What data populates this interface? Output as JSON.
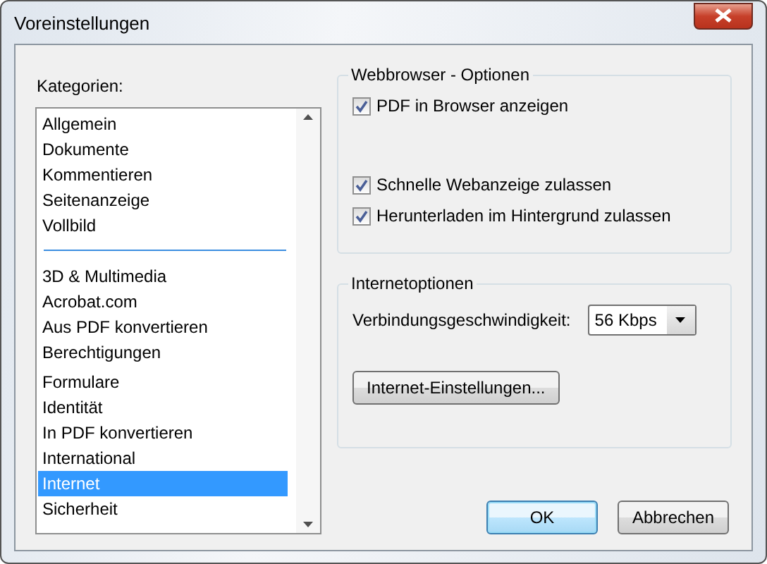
{
  "window": {
    "title": "Voreinstellungen"
  },
  "categories": {
    "label": "Kategorien:",
    "groups": [
      [
        {
          "label": "Allgemein",
          "selected": false
        },
        {
          "label": "Dokumente",
          "selected": false
        },
        {
          "label": "Kommentieren",
          "selected": false
        },
        {
          "label": "Seitenanzeige",
          "selected": false
        },
        {
          "label": "Vollbild",
          "selected": false
        }
      ],
      [
        {
          "label": "3D & Multimedia",
          "selected": false
        },
        {
          "label": "Acrobat.com",
          "selected": false
        },
        {
          "label": "Aus PDF konvertieren",
          "selected": false
        },
        {
          "label": "Berechtigungen",
          "selected": false
        },
        {
          "label": "Formulare",
          "selected": false
        },
        {
          "label": "Identität",
          "selected": false
        },
        {
          "label": "In PDF konvertieren",
          "selected": false
        },
        {
          "label": "International",
          "selected": false
        },
        {
          "label": "Internet",
          "selected": true
        },
        {
          "label": "Sicherheit",
          "selected": false
        }
      ]
    ]
  },
  "webbrowser": {
    "title": "Webbrowser - Optionen",
    "options": [
      {
        "label": "PDF in Browser anzeigen",
        "checked": true
      },
      {
        "label": "Schnelle Webanzeige zulassen",
        "checked": true
      },
      {
        "label": "Herunterladen im Hintergrund zulassen",
        "checked": true
      }
    ]
  },
  "internet": {
    "title": "Internetoptionen",
    "speed_label": "Verbindungsgeschwindigkeit:",
    "speed_value": "56 Kbps",
    "settings_button": "Internet-Einstellungen..."
  },
  "buttons": [
    {
      "label": "OK",
      "default": true
    },
    {
      "label": "Abbrechen",
      "default": false
    }
  ]
}
